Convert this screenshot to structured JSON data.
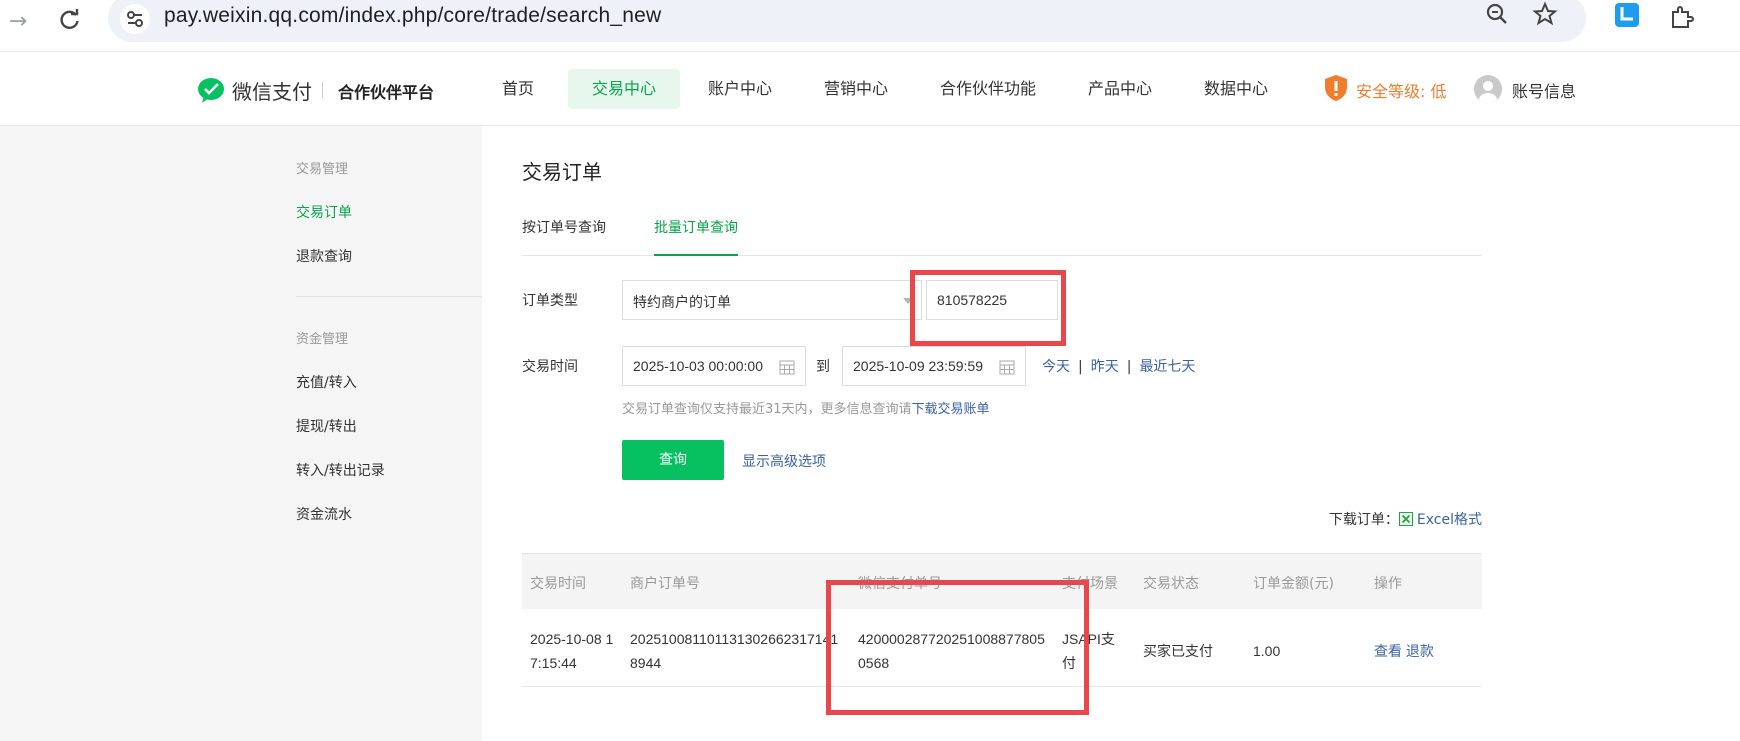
{
  "browser": {
    "url": "pay.weixin.qq.com/index.php/core/trade/search_new"
  },
  "header": {
    "brand_name": "微信支付",
    "brand_sub": "合作伙伴平台",
    "menu": [
      {
        "label": "首页",
        "active": false
      },
      {
        "label": "交易中心",
        "active": true
      },
      {
        "label": "账户中心",
        "active": false
      },
      {
        "label": "营销中心",
        "active": false
      },
      {
        "label": "合作伙伴功能",
        "active": false
      },
      {
        "label": "产品中心",
        "active": false
      },
      {
        "label": "数据中心",
        "active": false
      }
    ],
    "security_label": "安全等级: 低",
    "account_label": "账号信息"
  },
  "sidebar": {
    "group1": "交易管理",
    "items1": [
      "交易订单",
      "退款查询"
    ],
    "group2": "资金管理",
    "items2": [
      "充值/转入",
      "提现/转出",
      "转入/转出记录",
      "资金流水"
    ]
  },
  "main": {
    "title": "交易订单",
    "tabs": [
      "按订单号查询",
      "批量订单查询"
    ],
    "order_type_label": "订单类型",
    "order_type_value": "特约商户的订单",
    "merchant_id": "810578225",
    "time_label": "交易时间",
    "start_time": "2025-10-03 00:00:00",
    "to_label": "到",
    "end_time": "2025-10-09 23:59:59",
    "quick": [
      "今天",
      "昨天",
      "最近七天"
    ],
    "hint_text": "交易订单查询仅支持最近31天内，更多信息查询请",
    "hint_link": "下载交易账单",
    "query_button": "查询",
    "advanced_link": "显示高级选项",
    "download_label": "下载订单：",
    "download_link": "Excel格式"
  },
  "table": {
    "headers": [
      "交易时间",
      "商户订单号",
      "微信支付单号",
      "支付场景",
      "交易状态",
      "订单金额(元)",
      "操作"
    ],
    "rows": [
      {
        "time": "2025-10-08 17:15:44",
        "merchant_order": "2025100811011313026623171418944",
        "wx_order": "4200002877202510088778050568",
        "scene": "JSAPI支付",
        "status": "买家已支付",
        "amount": "1.00",
        "action_view": "查看",
        "action_refund": "退款"
      }
    ]
  },
  "colors": {
    "brand_green": "#07c160",
    "active_green": "#07a44c",
    "link_blue": "#3a62a8",
    "warning_orange": "#f07c2e",
    "annotation_red": "#e8474b"
  }
}
